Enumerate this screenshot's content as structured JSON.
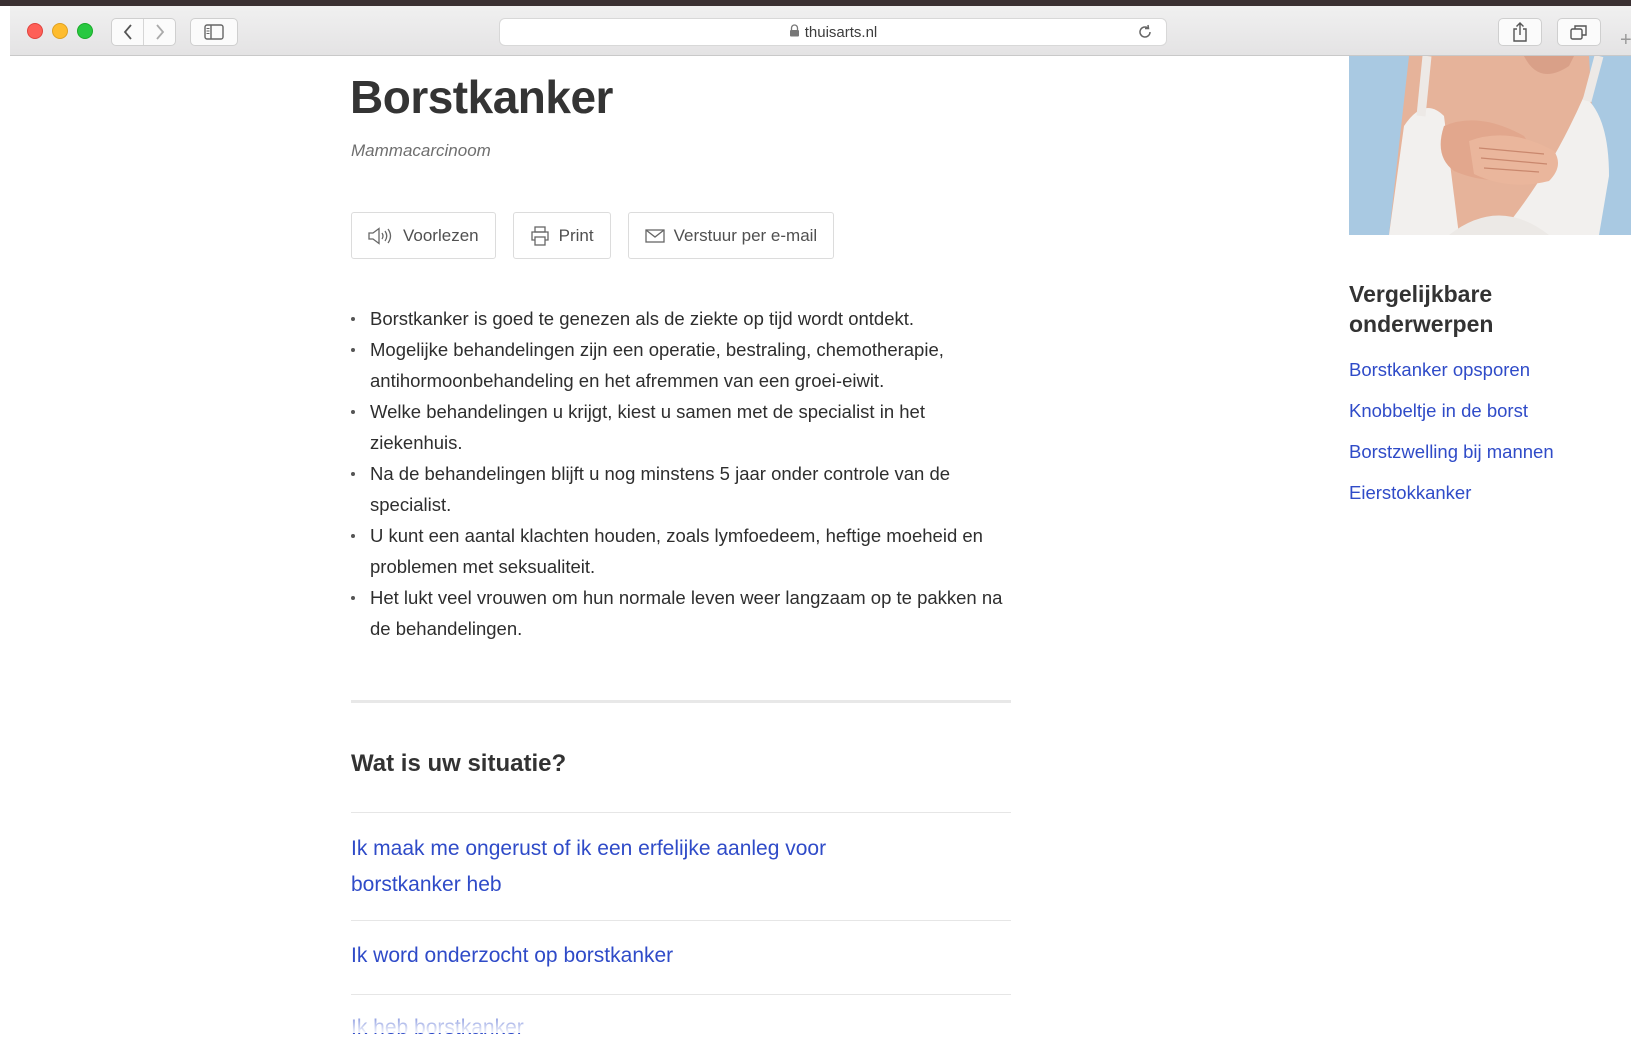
{
  "browser": {
    "url": "thuisarts.nl"
  },
  "article": {
    "title": "Borstkanker",
    "subtitle": "Mammacarcinoom",
    "actions": {
      "read_aloud": "Voorlezen",
      "print": "Print",
      "email": "Verstuur per e-mail"
    },
    "summary": [
      "Borstkanker is goed te genezen als de ziekte op tijd wordt ontdekt.",
      "Mogelijke behandelingen zijn een operatie, bestraling, chemotherapie, antihormoonbehandeling en het afremmen van een groei-eiwit.",
      "Welke behandelingen u krijgt, kiest u samen met de specialist in het ziekenhuis.",
      "Na de behandelingen blijft u nog minstens 5 jaar onder controle van de specialist.",
      "U kunt een aantal klachten houden, zoals lymfoedeem, heftige moeheid en problemen met seksualiteit.",
      "Het lukt veel vrouwen om hun normale leven weer langzaam op te pakken na de behandelingen."
    ]
  },
  "situation": {
    "title": "Wat is uw situatie?",
    "items": [
      "Ik maak me ongerust of ik een erfelijke aanleg voor borstkanker heb",
      "Ik word onderzocht op borstkanker",
      "Ik heb borstkanker"
    ]
  },
  "related": {
    "title": "Vergelijkbare onderwerpen",
    "links": [
      "Borstkanker opsporen",
      "Knobbeltje in de borst",
      "Borstzwelling bij mannen",
      "Eierstokkanker"
    ]
  },
  "colors": {
    "link": "#2f4bc8",
    "heading": "#343434"
  }
}
